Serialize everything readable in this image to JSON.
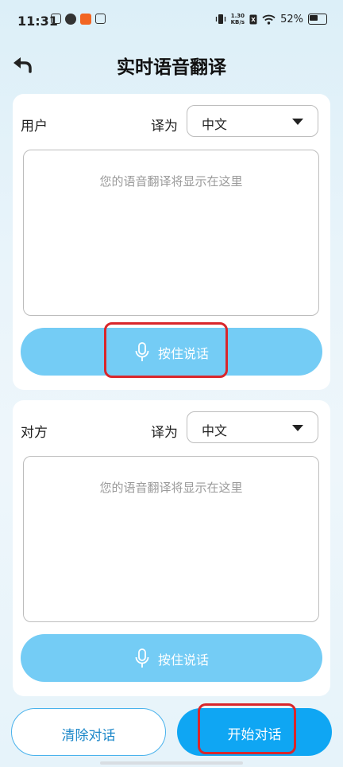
{
  "status_bar": {
    "time": "11:31",
    "net_speed_top": "1.30",
    "net_speed_bottom": "KB/s",
    "battery": "52%"
  },
  "header": {
    "title": "实时语音翻译"
  },
  "user_panel": {
    "speaker": "用户",
    "translate_to_label": "译为",
    "target_language": "中文",
    "placeholder": "您的语音翻译将显示在这里",
    "talk_button": "按住说话"
  },
  "other_panel": {
    "speaker": "对方",
    "translate_to_label": "译为",
    "target_language": "中文",
    "placeholder": "您的语音翻译将显示在这里",
    "talk_button": "按住说话"
  },
  "footer": {
    "clear_button": "清除对话",
    "start_button": "开始对话"
  },
  "colors": {
    "accent": "#0fa6f3",
    "talk_button": "#74ccf5",
    "highlight": "#d9262b"
  },
  "icons": [
    "back-arrow-icon",
    "microphone-icon",
    "dropdown-caret-icon",
    "wifi-icon",
    "battery-icon",
    "vibrate-icon"
  ]
}
